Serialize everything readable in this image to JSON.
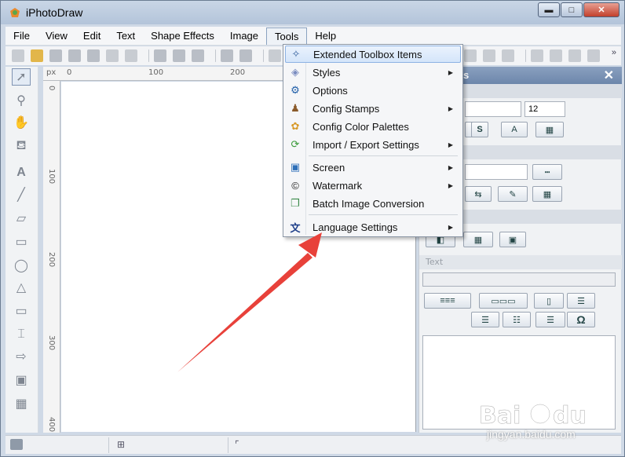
{
  "window": {
    "title": "iPhotoDraw",
    "minimize_glyph": "▬",
    "maximize_glyph": "□",
    "close_glyph": "✕"
  },
  "menubar": {
    "items": [
      "File",
      "View",
      "Edit",
      "Text",
      "Shape Effects",
      "Image",
      "Tools",
      "Help"
    ],
    "active": "Tools"
  },
  "ruler": {
    "unit": "px",
    "top_ticks": [
      "0",
      "100",
      "200"
    ],
    "left_ticks": [
      "0",
      "100",
      "200",
      "300",
      "400"
    ]
  },
  "tools_menu": {
    "items": [
      {
        "label": "Extended Toolbox Items",
        "icon": "wand-icon",
        "submenu": false,
        "highlighted": true
      },
      {
        "label": "Styles",
        "icon": "gem-icon",
        "submenu": true
      },
      {
        "label": "Options",
        "icon": "gear-icon",
        "submenu": false
      },
      {
        "label": "Config Stamps",
        "icon": "stamp-icon",
        "submenu": true
      },
      {
        "label": "Config Color Palettes",
        "icon": "palette-icon",
        "submenu": false
      },
      {
        "label": "Import / Export Settings",
        "icon": "sync-icon",
        "submenu": true
      },
      {
        "label": "Screen",
        "icon": "monitor-icon",
        "submenu": true
      },
      {
        "label": "Watermark",
        "icon": "copyright-icon",
        "submenu": true
      },
      {
        "label": "Batch Image Conversion",
        "icon": "batch-icon",
        "submenu": false
      },
      {
        "label": "Language Settings",
        "icon": "language-icon",
        "submenu": true
      }
    ]
  },
  "right_panel": {
    "title_fragment": "s",
    "close_glyph": "✕",
    "font_size": "12",
    "text_label": "Text",
    "omega": "Ω"
  },
  "watermark": {
    "url": "jingyan.baidu.com"
  },
  "colors": {
    "menu_highlight": "#d4e5fa",
    "arrow": "#e8413a",
    "title_gradient": "#b3c4da"
  }
}
